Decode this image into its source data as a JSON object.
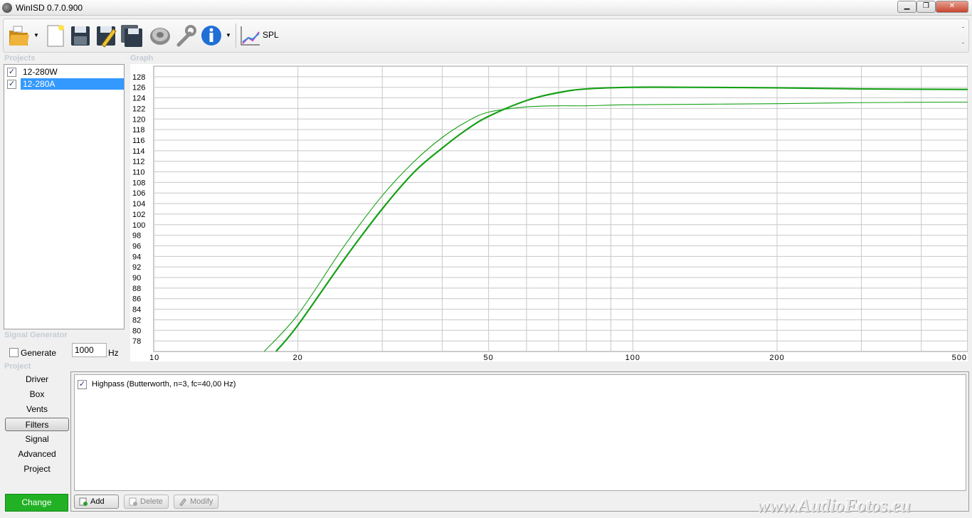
{
  "window": {
    "title": "WinISD 0.7.0.900"
  },
  "toolbar": {
    "items": [
      "open-icon",
      "new-icon",
      "save-icon",
      "save-as-icon",
      "save-all-icon",
      "driver-icon",
      "tools-icon",
      "info-icon",
      "spl-graph-icon"
    ],
    "graph_type_label": "SPL"
  },
  "sections": {
    "projects": "Projects",
    "graph": "Graph",
    "signal_generator": "Signal Generator",
    "project": "Project"
  },
  "projects": [
    {
      "name": "12-280W",
      "checked": true,
      "selected": false
    },
    {
      "name": "12-280A",
      "checked": true,
      "selected": true
    }
  ],
  "signal_generator": {
    "generate_label": "Generate",
    "generate_checked": false,
    "frequency": "1000",
    "unit": "Hz"
  },
  "project_nav": [
    "Driver",
    "Box",
    "Vents",
    "Filters",
    "Signal",
    "Advanced",
    "Project"
  ],
  "project_nav_active": "Filters",
  "change_button": "Change",
  "filters": {
    "items": [
      {
        "label": "Highpass (Butterworth, n=3, fc=40,00 Hz)",
        "checked": true
      }
    ],
    "add_label": "Add",
    "delete_label": "Delete",
    "modify_label": "Modify"
  },
  "chart_data": {
    "type": "line",
    "xscale": "log",
    "xlim": [
      10,
      500
    ],
    "ylim": [
      76,
      130
    ],
    "x_ticks": [
      10,
      20,
      50,
      100,
      200,
      500
    ],
    "y_ticks": [
      78,
      80,
      82,
      84,
      86,
      88,
      90,
      92,
      94,
      96,
      98,
      100,
      102,
      104,
      106,
      108,
      110,
      112,
      114,
      116,
      118,
      120,
      122,
      124,
      126,
      128
    ],
    "grid": true,
    "colors": {
      "series": "#16a016",
      "grid": "#c8c8c8"
    },
    "series": [
      {
        "x": [
          18,
          20,
          25,
          30,
          35,
          40,
          45,
          50,
          60,
          70,
          80,
          100,
          130,
          200,
          300,
          500
        ],
        "y": [
          76,
          81,
          93.5,
          103,
          110,
          114.5,
          118,
          120.5,
          123.5,
          125,
          125.7,
          126,
          126,
          125.9,
          125.7,
          125.6
        ]
      },
      {
        "x": [
          17,
          20,
          25,
          30,
          35,
          40,
          45,
          50,
          60,
          70,
          80,
          100,
          200,
          300,
          500
        ],
        "y": [
          76,
          83,
          96,
          105.5,
          112,
          116.5,
          119.5,
          121.3,
          122.3,
          122.5,
          122.5,
          122.7,
          122.9,
          123.1,
          123.2
        ]
      }
    ]
  },
  "watermark": "www.AudioFotos.eu"
}
